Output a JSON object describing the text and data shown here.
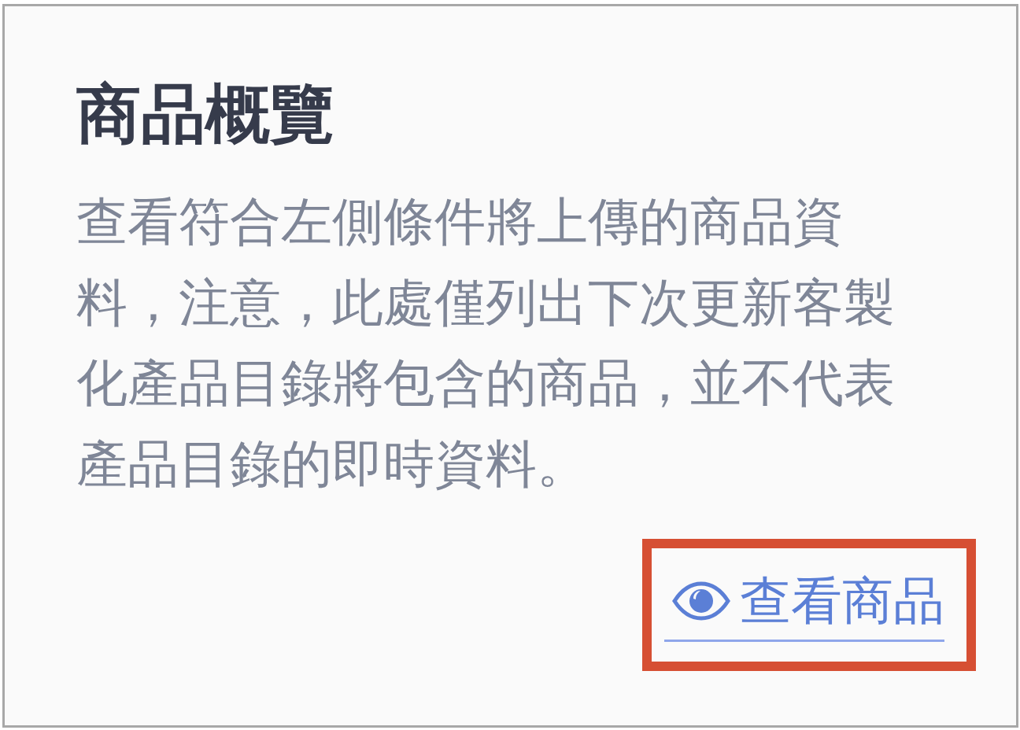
{
  "card": {
    "title": "商品概覽",
    "description": "查看符合左側條件將上傳的商品資料，注意，此處僅列出下次更新客製化產品目錄將包含的商品，並不代表產品目錄的即時資料。",
    "link": {
      "label": "查看商品",
      "highlighted": true
    }
  }
}
